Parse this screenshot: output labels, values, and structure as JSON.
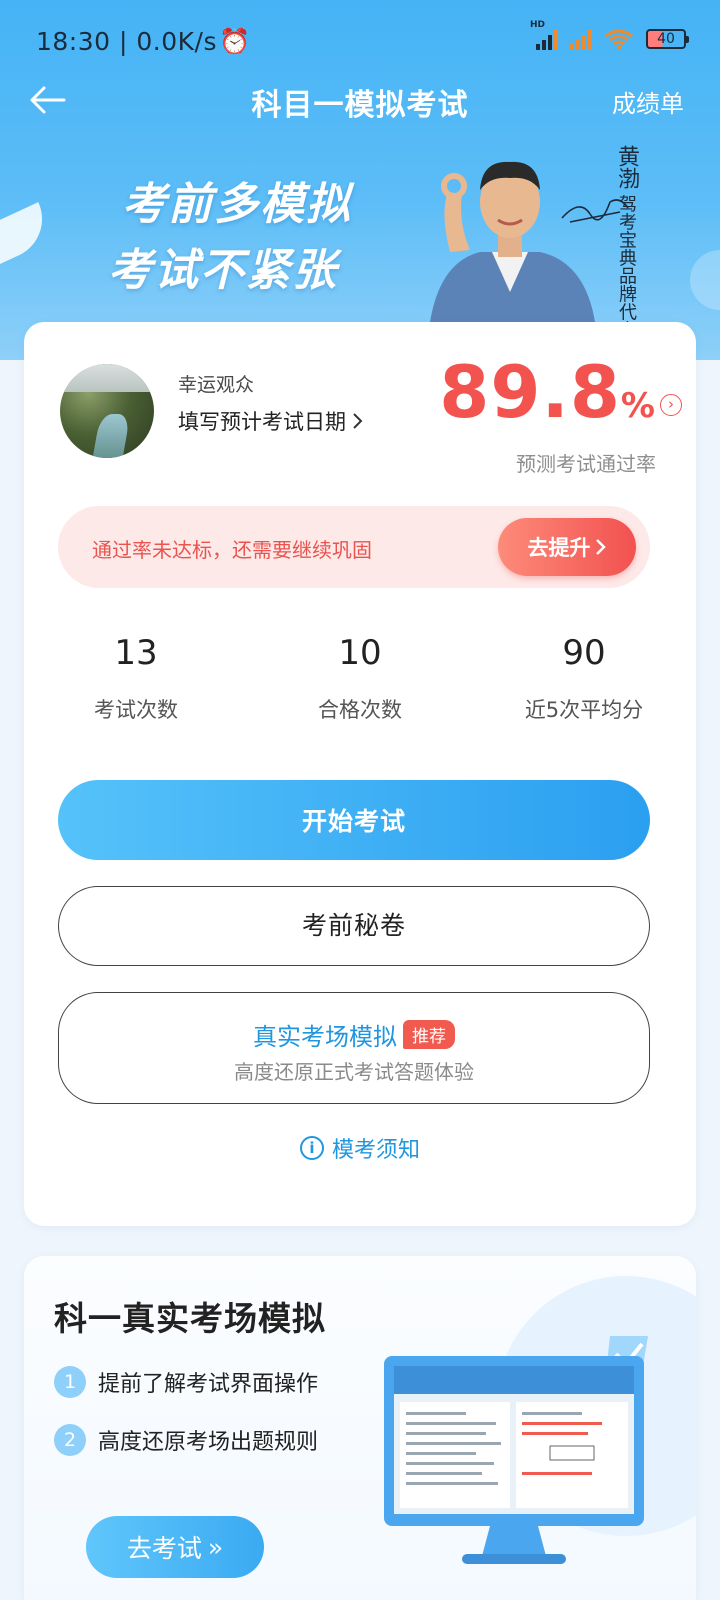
{
  "status_bar": {
    "time": "18:30 | 0.0K/s",
    "battery": "40"
  },
  "nav": {
    "title": "科目一模拟考试",
    "right_label": "成绩单"
  },
  "banner": {
    "line1": "考前多模拟",
    "line2": "考试不紧张",
    "spokesperson_name": "黄渤",
    "spokesperson_title": "驾考宝典品牌代言人"
  },
  "profile": {
    "nickname": "幸运观众",
    "date_link": "填写预计考试日期",
    "pass_rate": "89.8",
    "pass_rate_unit": "%",
    "pass_rate_caption": "预测考试通过率"
  },
  "tip": {
    "message": "通过率未达标，还需要继续巩固",
    "button": "去提升"
  },
  "stats": [
    {
      "value": "13",
      "label": "考试次数"
    },
    {
      "value": "10",
      "label": "合格次数"
    },
    {
      "value": "90",
      "label": "近5次平均分"
    }
  ],
  "actions": {
    "start": "开始考试",
    "secret": "考前秘卷",
    "sim_title": "真实考场模拟",
    "sim_tag": "推荐",
    "sim_sub": "高度还原正式考试答题体验",
    "notice": "模考须知"
  },
  "real_exam": {
    "heading": "科一真实考场模拟",
    "points": [
      {
        "num": "1",
        "text": "提前了解考试界面操作"
      },
      {
        "num": "2",
        "text": "高度还原考场出题规则"
      }
    ],
    "go_button": "去考试"
  },
  "colors": {
    "header_blue": "#45b3f5",
    "accent_red": "#f2534f",
    "primary_blue": "#2b9ff0"
  }
}
